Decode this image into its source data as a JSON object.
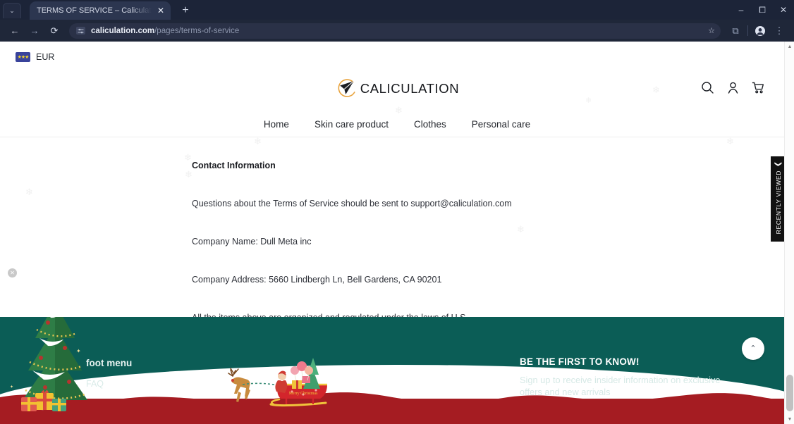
{
  "browser": {
    "tab": {
      "title": "TERMS OF SERVICE – Caliculation",
      "close_label": "✕"
    },
    "new_tab_label": "+",
    "tab_list_label": "⌄",
    "window": {
      "minimize": "–",
      "maximize": "⧠",
      "close": "✕"
    },
    "nav": {
      "back": "←",
      "forward": "→",
      "reload": "⟳"
    },
    "omnibox": {
      "domain": "caliculation.com",
      "path": "/pages/terms-of-service",
      "site_icon": "tune-icon",
      "bookmark_label": "☆"
    },
    "toolbar_right": {
      "extensions_label": "⧉",
      "profile_label": "●",
      "menu_label": "⋮"
    }
  },
  "topbar": {
    "currency": "EUR",
    "flag_icon": "eu-flag-icon"
  },
  "header": {
    "logo_text": "CALICULATION",
    "icons": {
      "search": "search-icon",
      "account": "account-icon",
      "cart": "cart-icon"
    },
    "nav": [
      {
        "label": "Home"
      },
      {
        "label": "Skin care product"
      },
      {
        "label": "Clothes"
      },
      {
        "label": "Personal care"
      }
    ]
  },
  "content": {
    "heading": "Contact Information",
    "paragraphs": [
      "Questions about the Terms of Service should be sent to support@caliculation.com",
      "Company Name: Dull Meta inc",
      "Company Address: 5660 Lindbergh Ln, Bell Gardens, CA 90201",
      "All the items above are organized and regulated under the laws of U.S."
    ]
  },
  "recently_viewed": {
    "label": "RECENTLY VIEWED",
    "chevron": "❮"
  },
  "popup_close": {
    "label": "✕"
  },
  "footer": {
    "menu_heading": "foot menu",
    "menu_links": [
      {
        "label": "FAQ"
      }
    ],
    "newsletter": {
      "heading": "BE THE FIRST TO KNOW!",
      "body": "Sign up to receive insider information on exclusive offers and new arrivals"
    },
    "back_to_top": "⌃",
    "sleigh_text": "Merry Christmas",
    "colors": {
      "background": "#0b5d56",
      "snow": "#ffffff",
      "red_band": "#a51c22"
    }
  },
  "scrollbar": {
    "up_arrow": "▲",
    "down_arrow": "▼"
  }
}
